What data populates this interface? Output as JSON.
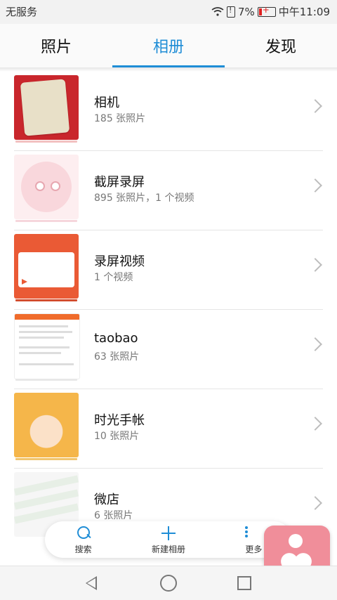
{
  "status_bar": {
    "carrier": "无服务",
    "battery": "7%",
    "time": "中午11:09"
  },
  "tabs": [
    {
      "label": "照片"
    },
    {
      "label": "相册",
      "active": true
    },
    {
      "label": "发现"
    }
  ],
  "albums": [
    {
      "title": "相机",
      "meta": "185 张照片"
    },
    {
      "title": "截屏录屏",
      "meta": "895 张照片，1 个视频"
    },
    {
      "title": "录屏视频",
      "meta": "1 个视频"
    },
    {
      "title": "taobao",
      "meta": "63 张照片"
    },
    {
      "title": "时光手帐",
      "meta": "10 张照片"
    },
    {
      "title": "微店",
      "meta": "6 张照片"
    }
  ],
  "toolbar": {
    "search": "搜索",
    "new_album": "新建相册",
    "more": "更多"
  },
  "colors": {
    "accent": "#1f8dd6",
    "badge": "#f08e9a"
  },
  "icons": [
    "wifi-icon",
    "sim-alert-icon",
    "battery-icon",
    "chevron-right-icon",
    "search-icon",
    "plus-icon",
    "more-icon",
    "back-icon",
    "home-icon",
    "recent-apps-icon",
    "heart-app-icon"
  ]
}
